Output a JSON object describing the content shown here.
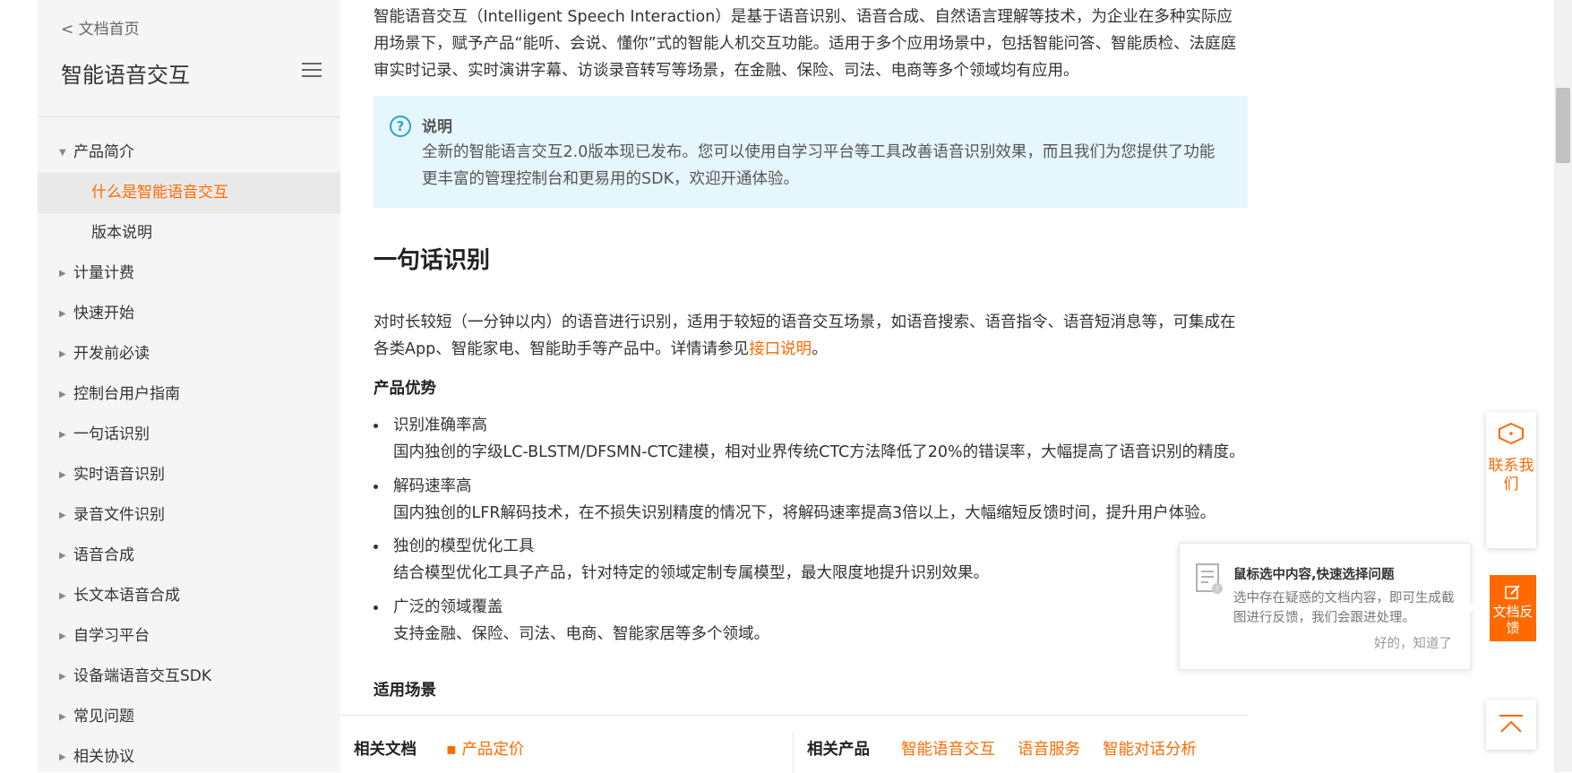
{
  "sidebar": {
    "back_link": "< 文档首页",
    "title": "智能语音交互",
    "items": [
      {
        "label": "产品简介",
        "expanded": true
      },
      {
        "label": "什么是智能语音交互",
        "sub": true,
        "active": true
      },
      {
        "label": "版本说明",
        "sub": true
      },
      {
        "label": "计量计费"
      },
      {
        "label": "快速开始"
      },
      {
        "label": "开发前必读"
      },
      {
        "label": "控制台用户指南"
      },
      {
        "label": "一句话识别"
      },
      {
        "label": "实时语音识别"
      },
      {
        "label": "录音文件识别"
      },
      {
        "label": "语音合成"
      },
      {
        "label": "长文本语音合成"
      },
      {
        "label": "自学习平台"
      },
      {
        "label": "设备端语音交互SDK"
      },
      {
        "label": "常见问题"
      },
      {
        "label": "相关协议"
      }
    ]
  },
  "main": {
    "intro": "智能语音交互（Intelligent Speech Interaction）是基于语音识别、语音合成、自然语言理解等技术，为企业在多种实际应用场景下，赋予产品“能听、会说、懂你”式的智能人机交互功能。适用于多个应用场景中，包括智能问答、智能质检、法庭庭审实时记录、实时演讲字幕、访谈录音转写等场景，在金融、保险、司法、电商等多个领域均有应用。",
    "note": {
      "title": "说明",
      "body": "全新的智能语言交互2.0版本现已发布。您可以使用自学习平台等工具改善语音识别效果，而且我们为您提供了功能更丰富的管理控制台和更易用的SDK，欢迎开通体验。"
    },
    "section_title": "一句话识别",
    "section_para": "对时长较短（一分钟以内）的语音进行识别，适用于较短的语音交互场景，如语音搜索、语音指令、语音短消息等，可集成在各类App、智能家电、智能助手等产品中。详情请参见",
    "section_link": "接口说明",
    "section_para_end": "。",
    "advantages_title": "产品优势",
    "advantages": [
      {
        "title": "识别准确率高",
        "desc": "国内独创的字级LC-BLSTM/DFSMN-CTC建模，相对业界传统CTC方法降低了20%的错误率，大幅提高了语音识别的精度。"
      },
      {
        "title": "解码速率高",
        "desc": "国内独创的LFR解码技术，在不损失识别精度的情况下，将解码速率提高3倍以上，大幅缩短反馈时间，提升用户体验。"
      },
      {
        "title": "独创的模型优化工具",
        "desc": "结合模型优化工具子产品，针对特定的领域定制专属模型，最大限度地提升识别效果。"
      },
      {
        "title": "广泛的领域覆盖",
        "desc": "支持金融、保险、司法、电商、智能家居等多个领域。"
      }
    ],
    "scenarios_title": "适用场景"
  },
  "related": {
    "docs_label": "相关文档",
    "docs_link": "产品定价",
    "products_label": "相关产品",
    "products": [
      "智能语音交互",
      "语音服务",
      "智能对话分析"
    ]
  },
  "floating": {
    "contact": "联系我们",
    "feedback": "文档反馈",
    "tip_title": "鼠标选中内容,快速选择问题",
    "tip_body": "选中存在疑惑的文档内容，即可生成截图进行反馈，我们会跟进处理。",
    "tip_ok": "好的，知道了"
  },
  "colors": {
    "accent": "#ff6a00",
    "note_bg": "#e6f6fd",
    "note_icon": "#2ba1d9"
  }
}
